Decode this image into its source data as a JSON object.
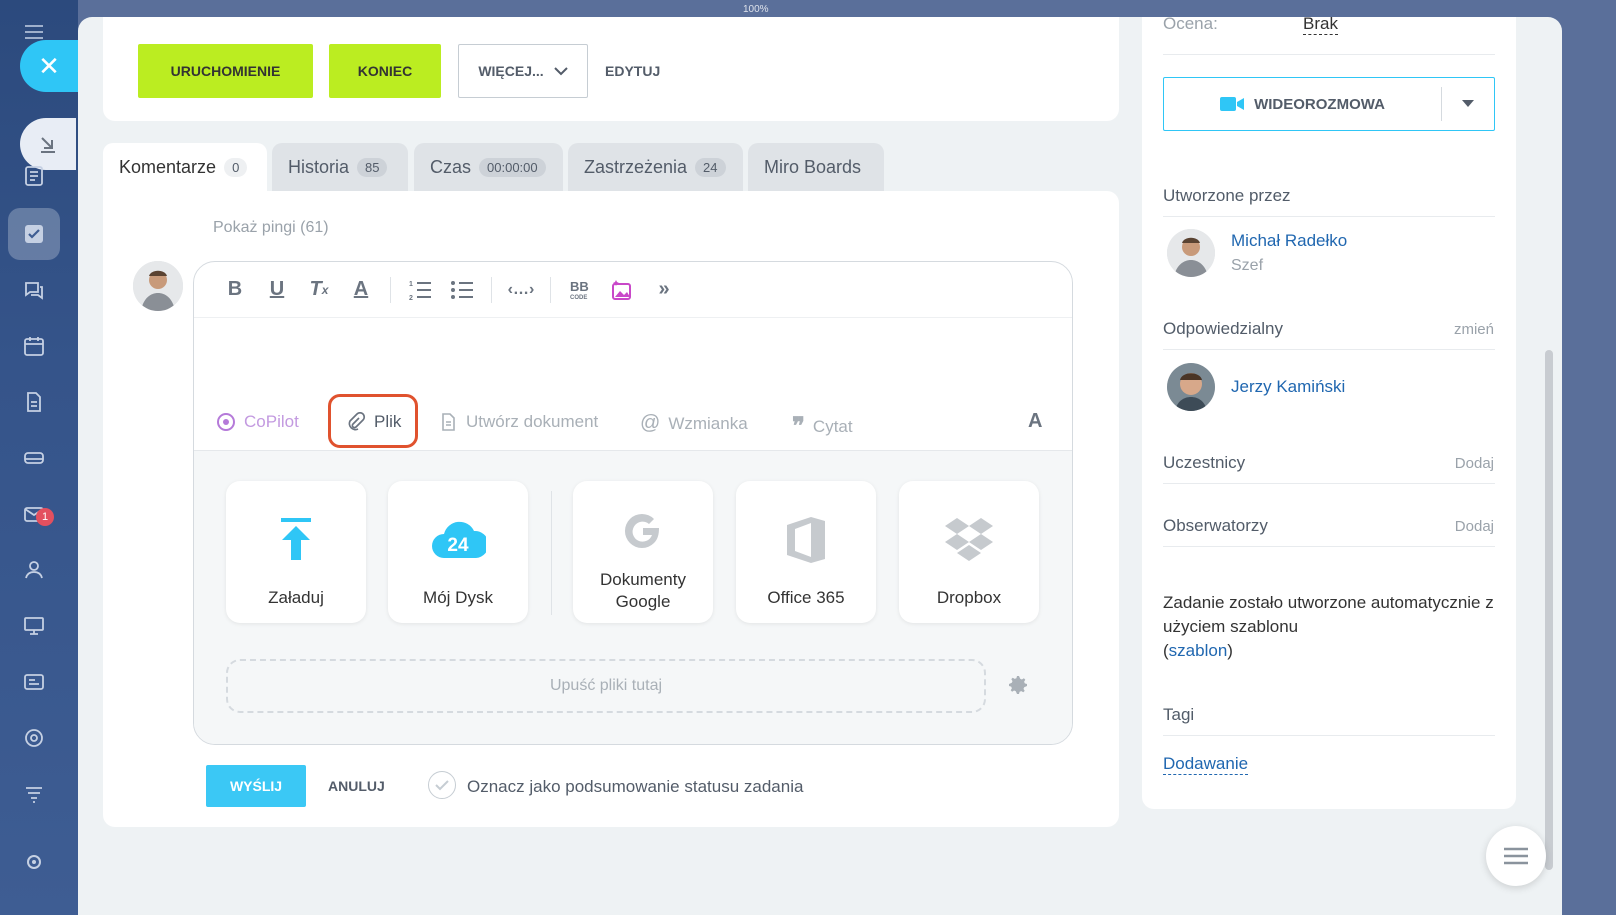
{
  "toolbar": {
    "start_label": "URUCHOMIENIE",
    "end_label": "KONIEC",
    "more_label": "WIĘCEJ...",
    "edit_label": "EDYTUJ"
  },
  "zoom": "100%",
  "tabs": [
    {
      "label": "Komentarze",
      "count": "0"
    },
    {
      "label": "Historia",
      "count": "85"
    },
    {
      "label": "Czas",
      "count": "00:00:00"
    },
    {
      "label": "Zastrzeżenia",
      "count": "24"
    },
    {
      "label": "Miro Boards"
    }
  ],
  "comments": {
    "pings_label": "Pokaż pingi (61)",
    "actions": {
      "copilot": "CoPilot",
      "file": "Plik",
      "create_doc": "Utwórz dokument",
      "mention": "Wzmianka",
      "quote": "Cytat",
      "font": "A"
    },
    "sources": [
      {
        "label": "Załaduj"
      },
      {
        "label": "Mój Dysk",
        "badge": "24"
      },
      {
        "label": "Dokumenty Google"
      },
      {
        "label": "Office 365"
      },
      {
        "label": "Dropbox"
      }
    ],
    "drop_label": "Upuść pliki tutaj",
    "send_label": "WYŚLIJ",
    "cancel_label": "ANULUJ",
    "mark_summary_label": "Oznacz jako podsumowanie statusu zadania"
  },
  "sidebar": {
    "rating_label": "Ocena:",
    "rating_value": "Brak",
    "video_label": "WIDEOROZMOWA",
    "created_by_label": "Utworzone przez",
    "creator": {
      "name": "Michał Radełko",
      "role": "Szef"
    },
    "responsible_label": "Odpowiedzialny",
    "change_label": "zmień",
    "responsible": {
      "name": "Jerzy Kamiński"
    },
    "participants_label": "Uczestnicy",
    "observers_label": "Obserwatorzy",
    "add_label": "Dodaj",
    "template_note": "Zadanie zostało utworzone automatycznie z użyciem szablonu",
    "template_link": "szablon",
    "tags_label": "Tagi",
    "tags_add": "Dodawanie"
  },
  "left_nav": {
    "mail_badge": "1"
  },
  "colors": {
    "accent_green": "#bbed21",
    "accent_blue": "#2fc6f6",
    "highlight": "#e0522e",
    "link": "#2067b0"
  }
}
